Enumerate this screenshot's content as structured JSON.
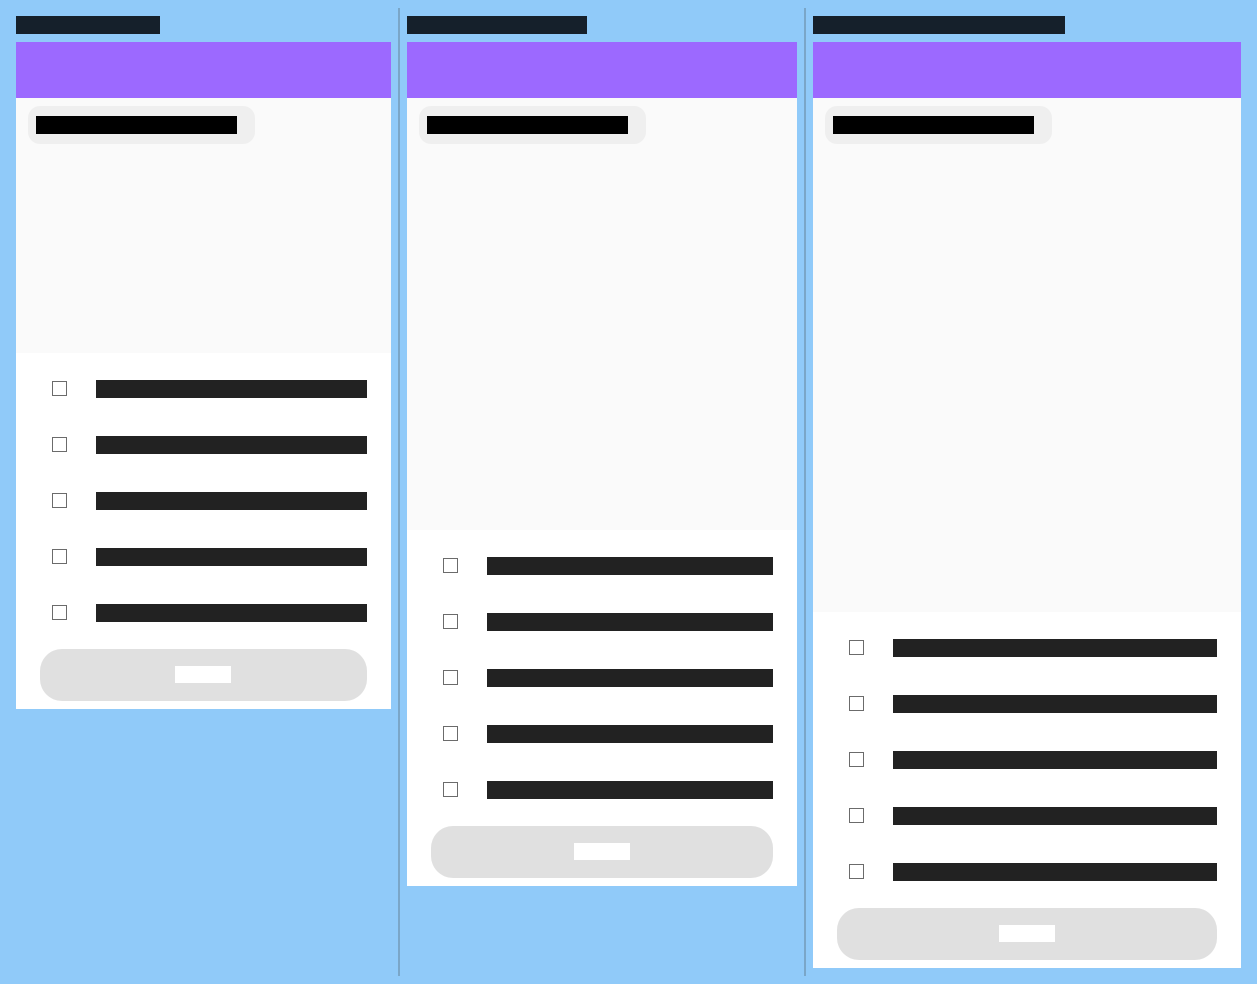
{
  "background_color": "#90caf9",
  "header_color": "#9c69ff",
  "panels": [
    {
      "title": "",
      "question": "",
      "options": [
        {
          "label": "",
          "checked": false
        },
        {
          "label": "",
          "checked": false
        },
        {
          "label": "",
          "checked": false
        },
        {
          "label": "",
          "checked": false
        },
        {
          "label": "",
          "checked": false
        }
      ],
      "submit_label": ""
    },
    {
      "title": "",
      "question": "",
      "options": [
        {
          "label": "",
          "checked": false
        },
        {
          "label": "",
          "checked": false
        },
        {
          "label": "",
          "checked": false
        },
        {
          "label": "",
          "checked": false
        },
        {
          "label": "",
          "checked": false
        }
      ],
      "submit_label": ""
    },
    {
      "title": "",
      "question": "",
      "options": [
        {
          "label": "",
          "checked": false
        },
        {
          "label": "",
          "checked": false
        },
        {
          "label": "",
          "checked": false
        },
        {
          "label": "",
          "checked": false
        },
        {
          "label": "",
          "checked": false
        }
      ],
      "submit_label": ""
    }
  ]
}
